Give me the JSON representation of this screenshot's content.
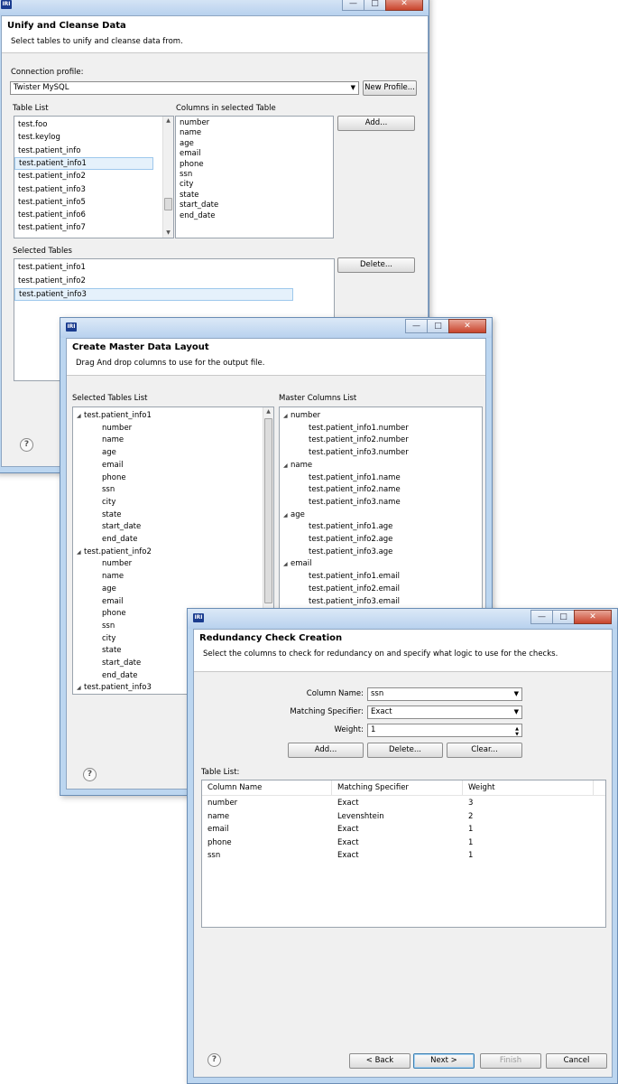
{
  "win1": {
    "header_title": "Unify and Cleanse Data",
    "header_subtitle": "Select tables to unify and cleanse data from.",
    "connection_label": "Connection profile:",
    "connection_value": "Twister MySQL",
    "new_profile_label": "New Profile...",
    "table_list_label": "Table List",
    "tables": [
      "test.foo",
      "test.keylog",
      "test.patient_info",
      "test.patient_info1",
      "test.patient_info2",
      "test.patient_info3",
      "test.patient_info5",
      "test.patient_info6",
      "test.patient_info7"
    ],
    "columns_label": "Columns in selected Table",
    "columns": [
      "number",
      "name",
      "age",
      "email",
      "phone",
      "ssn",
      "city",
      "state",
      "start_date",
      "end_date"
    ],
    "add_label": "Add...",
    "selected_tables_label": "Selected Tables",
    "selected_tables": [
      "test.patient_info1",
      "test.patient_info2",
      "test.patient_info3"
    ],
    "delete_label": "Delete...",
    "help": "?"
  },
  "win2": {
    "header_title": "Create Master Data Layout",
    "header_subtitle": "Drag And drop columns to use for the output file.",
    "selected_tables_list_label": "Selected Tables List",
    "tree": [
      {
        "table": "test.patient_info1",
        "columns": [
          "number",
          "name",
          "age",
          "email",
          "phone",
          "ssn",
          "city",
          "state",
          "start_date",
          "end_date"
        ]
      },
      {
        "table": "test.patient_info2",
        "columns": [
          "number",
          "name",
          "age",
          "email",
          "phone",
          "ssn",
          "city",
          "state",
          "start_date",
          "end_date"
        ]
      },
      {
        "table": "test.patient_info3",
        "columns": []
      }
    ],
    "master_columns_label": "Master Columns List",
    "master": [
      {
        "name": "number",
        "children": [
          "test.patient_info1.number",
          "test.patient_info2.number",
          "test.patient_info3.number"
        ]
      },
      {
        "name": "name",
        "children": [
          "test.patient_info1.name",
          "test.patient_info2.name",
          "test.patient_info3.name"
        ]
      },
      {
        "name": "age",
        "children": [
          "test.patient_info1.age",
          "test.patient_info2.age",
          "test.patient_info3.age"
        ]
      },
      {
        "name": "email",
        "children": [
          "test.patient_info1.email",
          "test.patient_info2.email",
          "test.patient_info3.email"
        ]
      }
    ],
    "help": "?"
  },
  "win3": {
    "header_title": "Redundancy Check Creation",
    "header_subtitle": "Select the columns to check for redundancy on and specify what logic to use for the checks.",
    "column_name_label": "Column Name:",
    "column_name_value": "ssn",
    "matching_label": "Matching Specifier:",
    "matching_value": "Exact",
    "weight_label": "Weight:",
    "weight_value": "1",
    "add_label": "Add...",
    "delete_label": "Delete...",
    "clear_label": "Clear...",
    "table_list_label": "Table List:",
    "headers": [
      "Column Name",
      "Matching Specifier",
      "Weight"
    ],
    "rows": [
      [
        "number",
        "Exact",
        "3"
      ],
      [
        "name",
        "Levenshtein",
        "2"
      ],
      [
        "email",
        "Exact",
        "1"
      ],
      [
        "phone",
        "Exact",
        "1"
      ],
      [
        "ssn",
        "Exact",
        "1"
      ]
    ],
    "back_label": "< Back",
    "next_label": "Next >",
    "finish_label": "Finish",
    "cancel_label": "Cancel",
    "help": "?"
  },
  "icons": {
    "app": "iri-app-icon",
    "minimize": "minimize-icon",
    "maximize": "maximize-icon",
    "close": "close-icon",
    "help": "help-icon"
  },
  "colors": {
    "selection": "#e5f1fb",
    "titlebar": "#b8d1ee",
    "close_button": "#c9442c"
  }
}
